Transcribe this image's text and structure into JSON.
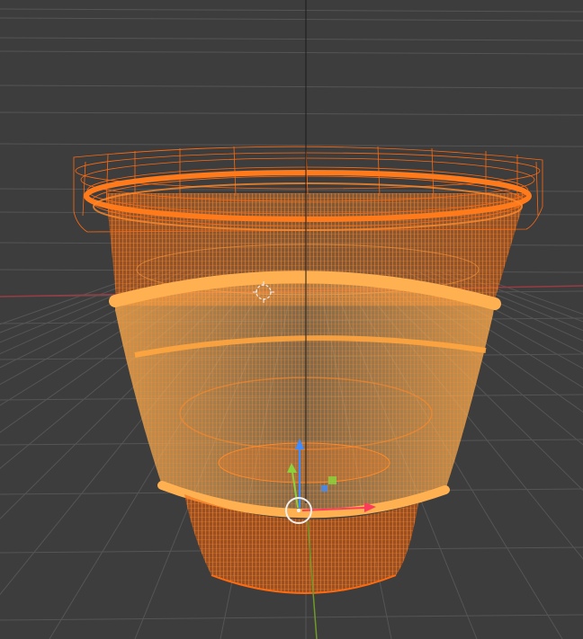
{
  "viewport": {
    "mode": "wireframe",
    "background_color": "#3d3d3d",
    "grid_color": "#555555",
    "grid_axis_x_color": "#9a3b43",
    "grid_axis_y_color": "#6f9a2a",
    "axis_z_color": "#1a1a1a"
  },
  "object": {
    "kind": "bucket-mesh",
    "selected_color": "#ff7a1a",
    "active_color": "#ffae4a",
    "wire_dark_color": "#e8600e"
  },
  "gizmo": {
    "x_color": "#ff3b5c",
    "y_color": "#8ad13b",
    "z_color": "#3f8cff",
    "pivot_color": "#f0f0f0"
  },
  "cursor": {
    "color": "#f0f0f0",
    "accent": "#ff3333"
  }
}
